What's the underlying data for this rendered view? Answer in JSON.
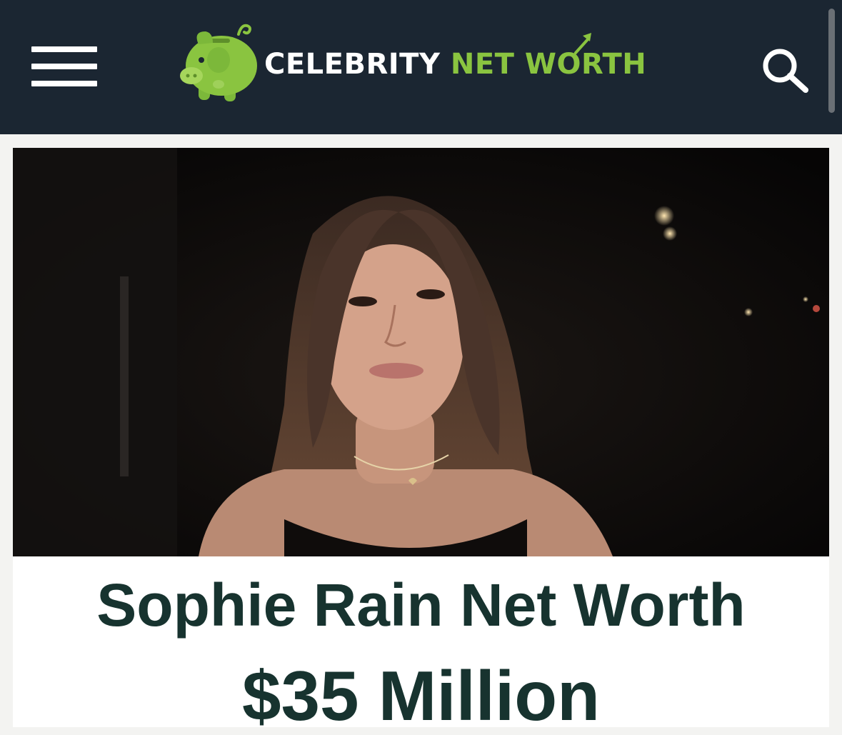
{
  "header": {
    "menu_icon": "hamburger-menu-icon",
    "logo": {
      "word1": "CELEBRITY",
      "word2": "NET WORTH",
      "icon": "piggy-bank-icon"
    },
    "search_icon": "search-icon"
  },
  "article": {
    "photo_alt": "Sophie Rain",
    "title": "Sophie Rain Net Worth",
    "net_worth": "$35 Million"
  },
  "colors": {
    "header_bg": "#1b2632",
    "brand_green": "#8ac440",
    "heading_text": "#17332f"
  }
}
